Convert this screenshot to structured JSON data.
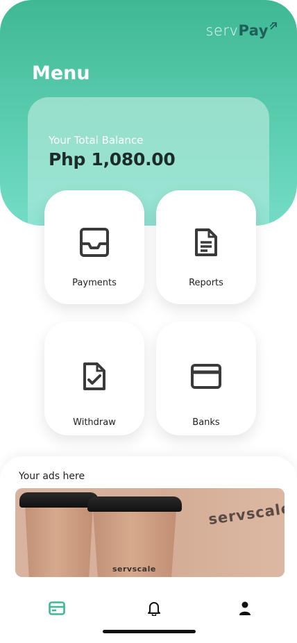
{
  "app": {
    "logo_prefix": "serv",
    "logo_suffix": "Pay",
    "page_title": "Menu"
  },
  "balance": {
    "label": "Your Total Balance",
    "amount": "Php 1,080.00"
  },
  "menu": {
    "payments": "Payments",
    "reports": "Reports",
    "withdraw": "Withdraw",
    "banks": "Banks"
  },
  "ads": {
    "title": "Your ads here",
    "brand_big": "servscale",
    "brand_small": "servscale"
  },
  "tabs": {
    "home_icon": "card-icon",
    "notifications_icon": "bell-icon",
    "profile_icon": "person-icon"
  },
  "colors": {
    "accent": "#3fb894",
    "accent_light": "#74dcc6",
    "logo_dark": "#1f5f59",
    "text_dark": "#1d2b2a"
  }
}
